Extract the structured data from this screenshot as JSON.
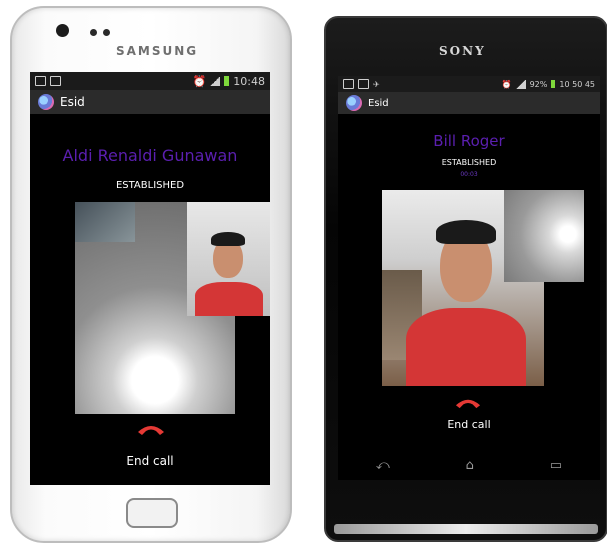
{
  "samsung": {
    "brand": "SAMSUNG",
    "status_time": "10:48",
    "app_name": "Esid",
    "caller_name": "Aldi Renaldi Gunawan",
    "call_status": "ESTABLISHED",
    "end_call_label": "End call"
  },
  "sony": {
    "brand": "SONY",
    "status_battery": "92%",
    "status_time": "10 50 45",
    "app_name": "Esid",
    "caller_name": "Bill Roger",
    "call_status": "ESTABLISHED",
    "call_timer": "00:03",
    "end_call_label": "End call"
  },
  "colors": {
    "caller_name": "#5b1fb0",
    "end_call_icon": "#e53935",
    "battery": "#7fd83b",
    "shirt": "#d43636"
  },
  "icons": [
    "end-call-icon",
    "app-logo-icon",
    "back-icon",
    "home-icon",
    "recent-apps-icon"
  ]
}
